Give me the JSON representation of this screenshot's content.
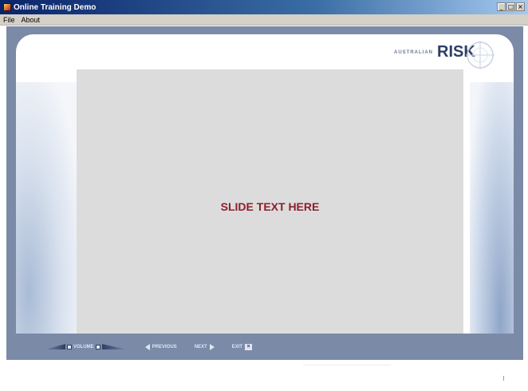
{
  "window": {
    "title": "Online Training Demo",
    "controls": [
      "_",
      "□",
      "×"
    ]
  },
  "menu": [
    {
      "label": "File"
    },
    {
      "label": "About"
    }
  ],
  "logo": {
    "small_text": "AUSTRALIAN",
    "big_text": "RISK"
  },
  "slide": {
    "text": "SLIDE TEXT HERE"
  },
  "nav": {
    "volume_label": "VOLUME",
    "previous_label": "PREVIOUS",
    "next_label": "NEXT",
    "exit_label": "EXIT",
    "exit_icon": "×"
  },
  "colors": {
    "frame": "#7b8aa7",
    "slide_bg": "#dcdcdc",
    "slide_text": "#8b1f2a",
    "logo_text": "#2c3e66"
  }
}
